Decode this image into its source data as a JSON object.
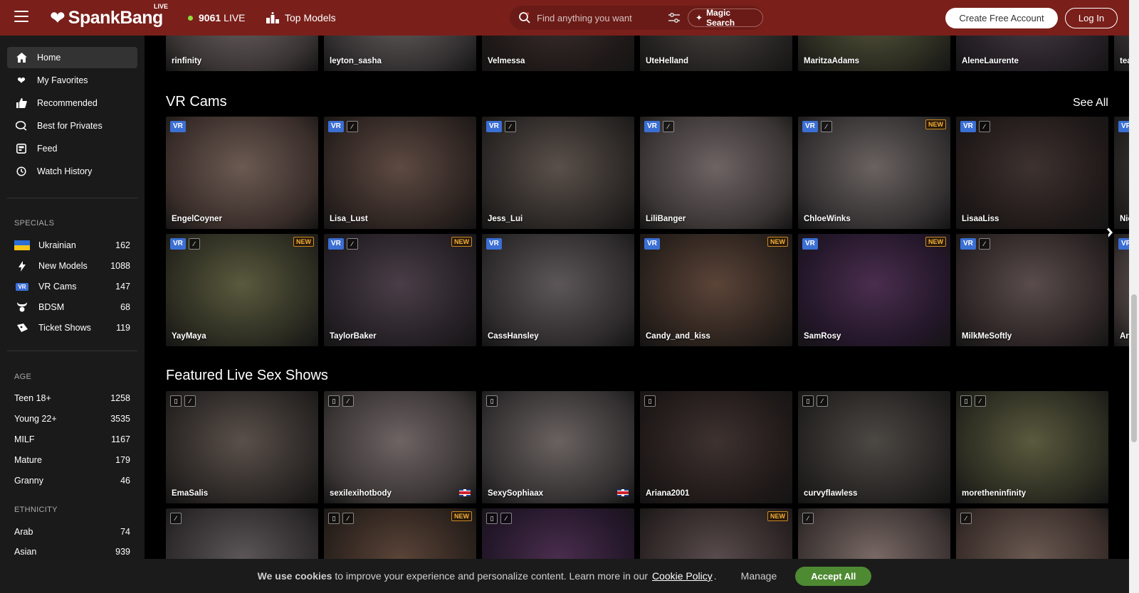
{
  "header": {
    "logo_text": "SpankBang",
    "logo_live": "LIVE",
    "live_count": "9061",
    "live_label": "LIVE",
    "top_models": "Top Models",
    "search_placeholder": "Find anything you want",
    "magic_search": "Magic Search",
    "create_account": "Create Free Account",
    "login": "Log In"
  },
  "sidebar": {
    "nav": [
      {
        "label": "Home",
        "icon": "home-icon"
      },
      {
        "label": "My Favorites",
        "icon": "heart-icon"
      },
      {
        "label": "Recommended",
        "icon": "thumbs-up-icon"
      },
      {
        "label": "Best for Privates",
        "icon": "chat-icon"
      },
      {
        "label": "Feed",
        "icon": "feed-icon"
      },
      {
        "label": "Watch History",
        "icon": "history-icon"
      }
    ],
    "specials_heading": "SPECIALS",
    "specials": [
      {
        "label": "Ukrainian",
        "count": "162"
      },
      {
        "label": "New Models",
        "count": "1088"
      },
      {
        "label": "VR Cams",
        "count": "147"
      },
      {
        "label": "BDSM",
        "count": "68"
      },
      {
        "label": "Ticket Shows",
        "count": "119"
      }
    ],
    "age_heading": "AGE",
    "age": [
      {
        "label": "Teen 18+",
        "count": "1258"
      },
      {
        "label": "Young 22+",
        "count": "3535"
      },
      {
        "label": "MILF",
        "count": "1167"
      },
      {
        "label": "Mature",
        "count": "179"
      },
      {
        "label": "Granny",
        "count": "46"
      }
    ],
    "ethnicity_heading": "ETHNICITY",
    "ethnicity": [
      {
        "label": "Arab",
        "count": "74"
      },
      {
        "label": "Asian",
        "count": "939"
      }
    ]
  },
  "main": {
    "top_row": [
      "rinfinity",
      "leyton_sasha",
      "Velmessa",
      "UteHelland",
      "MaritzaAdams",
      "AleneLaurente",
      "tea"
    ],
    "vr_title": "VR Cams",
    "see_all": "See All",
    "vr_badge": "VR",
    "new_badge": "NEW",
    "vr_row1": [
      {
        "name": "EngelCoyner",
        "mobile": false,
        "new": false
      },
      {
        "name": "Lisa_Lust",
        "mobile": true,
        "new": false
      },
      {
        "name": "Jess_Lui",
        "mobile": true,
        "new": false
      },
      {
        "name": "LiliBanger",
        "mobile": true,
        "new": false
      },
      {
        "name": "ChloeWinks",
        "mobile": true,
        "new": true
      },
      {
        "name": "LisaaLiss",
        "mobile": true,
        "new": false
      },
      {
        "name": "Nic",
        "mobile": false,
        "new": false
      }
    ],
    "vr_row2": [
      {
        "name": "YayMaya",
        "mobile": true,
        "new": true
      },
      {
        "name": "TaylorBaker",
        "mobile": true,
        "new": true
      },
      {
        "name": "CassHansley",
        "mobile": false,
        "new": false
      },
      {
        "name": "Candy_and_kiss",
        "mobile": false,
        "new": true
      },
      {
        "name": "SamRosy",
        "mobile": false,
        "new": true
      },
      {
        "name": "MilkMeSoftly",
        "mobile": true,
        "new": false
      },
      {
        "name": "Ari",
        "mobile": false,
        "new": false
      }
    ],
    "featured_title": "Featured Live Sex Shows",
    "featured_row1": [
      {
        "name": "EmaSalis",
        "phone": true,
        "hd": true,
        "uk": false
      },
      {
        "name": "sexilexihotbody",
        "phone": true,
        "hd": true,
        "uk": true
      },
      {
        "name": "SexySophiaax",
        "phone": true,
        "hd": false,
        "uk": true
      },
      {
        "name": "Ariana2001",
        "phone": true,
        "hd": false,
        "uk": false
      },
      {
        "name": "curvyflawless",
        "phone": true,
        "hd": true,
        "uk": false
      },
      {
        "name": "moretheninfinity",
        "phone": true,
        "hd": true,
        "uk": false
      }
    ],
    "featured_row2": [
      {
        "phone": false,
        "hd": true,
        "new": false
      },
      {
        "phone": true,
        "hd": true,
        "new": true
      },
      {
        "phone": true,
        "hd": true,
        "new": false
      },
      {
        "phone": false,
        "hd": false,
        "new": true
      },
      {
        "phone": false,
        "hd": true,
        "new": false
      },
      {
        "phone": false,
        "hd": true,
        "new": false
      }
    ]
  },
  "cookie": {
    "text_bold_1": "We use",
    "text_bold_2": "cookies",
    "text_rest": "to improve your experience and personalize content. Learn more in our",
    "policy_link": "Cookie Policy",
    "period": ".",
    "manage": "Manage",
    "accept": "Accept All"
  }
}
